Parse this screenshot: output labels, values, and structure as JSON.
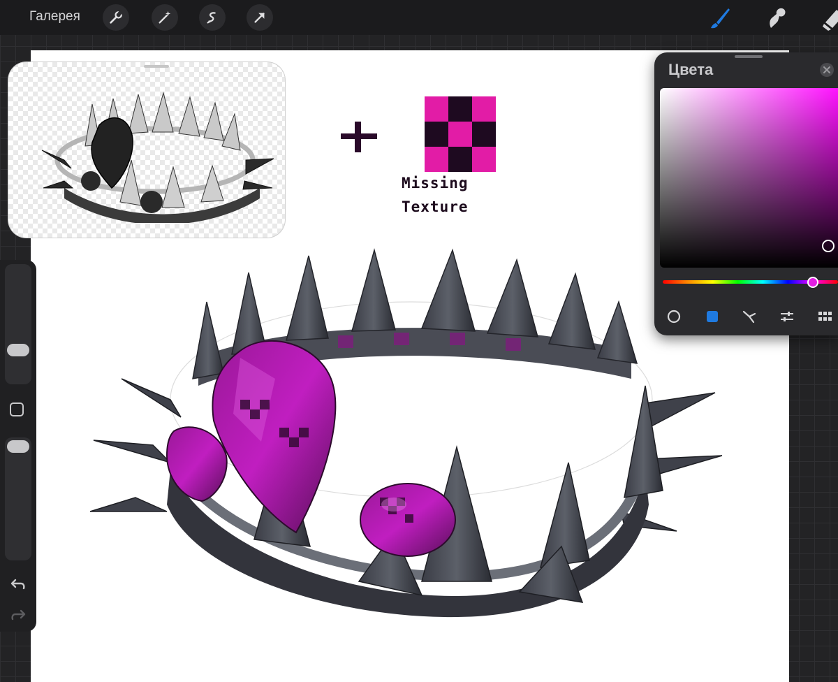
{
  "toolbar": {
    "gallery_label": "Галерея",
    "left_tools": [
      "wrench-icon",
      "magic-wand-icon",
      "selection-icon",
      "transform-arrow-icon"
    ],
    "right_tools": [
      "brush-icon",
      "smudge-icon",
      "eraser-icon"
    ],
    "active_tool": "brush-icon",
    "accent_color": "#1f7ae0"
  },
  "reference": {
    "caption_line1": "Missing",
    "caption_line2": "Texture",
    "plus_color": "#2a0a2a",
    "checker_colors": [
      "#e21ca6",
      "#1e0a20"
    ]
  },
  "colors_panel": {
    "title": "Цвета",
    "current_color": "#d715d7",
    "hue_position": 0.87,
    "picker_saturation": 0.98,
    "picker_brightness": 0.1,
    "tabs": [
      "disc-icon",
      "classic-icon",
      "harmony-icon",
      "value-icon",
      "palettes-icon"
    ],
    "active_tab": "classic-icon"
  },
  "sidebar": {
    "brush_size_level": 0.7,
    "opacity_level": 0.95,
    "undo_icon": "undo-icon",
    "redo_icon": "redo-icon"
  }
}
